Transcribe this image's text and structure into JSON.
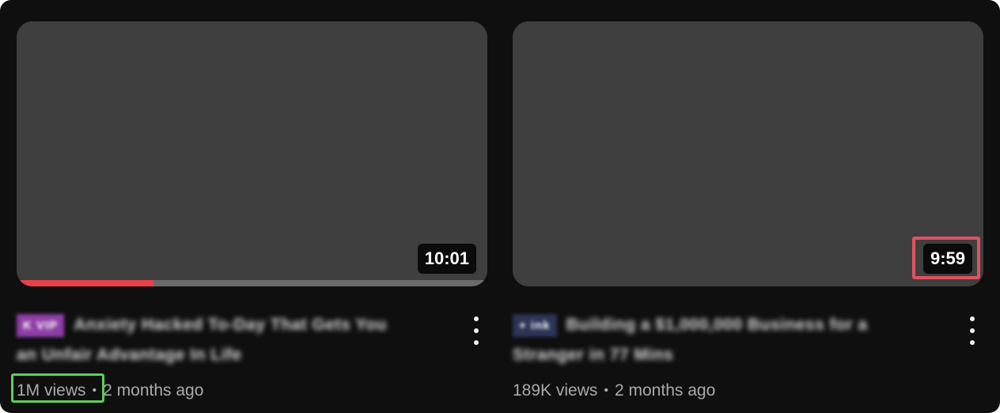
{
  "videos": [
    {
      "duration": "10:01",
      "watch_progress": 0.29,
      "channel_tag": "K VIP",
      "channel_tag_color": "#8e3fa6",
      "title_line1": "Anxiety Hacked To-Day That Gets You",
      "title_line2": "an Unfair Advantage In Life",
      "views": "1M views",
      "separator": "•",
      "age": "2 months ago"
    },
    {
      "duration": "9:59",
      "channel_tag": "+ ink",
      "channel_tag_color": "#2b3457",
      "title_line1": "Building a $1,000,000 Business for a",
      "title_line2": "Stranger in 77 Mins",
      "views": "189K views",
      "separator": "•",
      "age": "2 months ago"
    }
  ],
  "annotations": {
    "highlight_colors": [
      "#e05260",
      "#5fce58"
    ]
  },
  "icons": {
    "more": "more-vertical-icon"
  }
}
